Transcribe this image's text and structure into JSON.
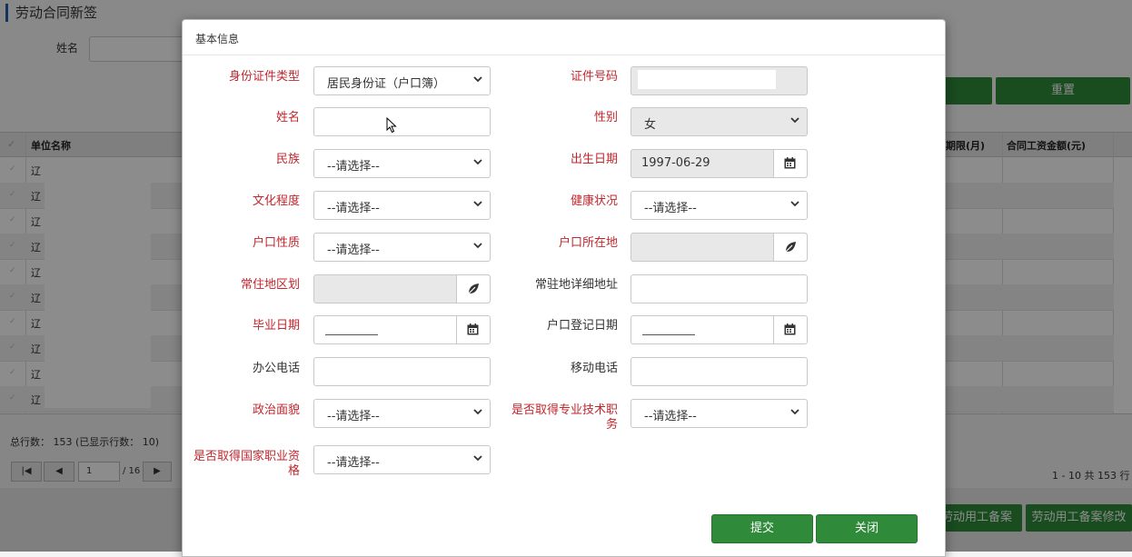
{
  "background": {
    "page_title": "劳动合同新签",
    "search_label": "姓名",
    "reset_button": "重置",
    "grid": {
      "headers": [
        "单位名称",
        "期限(月)",
        "合同工资金额(元)"
      ],
      "row_prefix": [
        "辽",
        "辽",
        "辽",
        "辽",
        "辽",
        "辽",
        "辽",
        "辽",
        "辽",
        "辽"
      ]
    },
    "total_rows": "总行数： 153 (已显示行数： 10)",
    "page_input": "1",
    "page_total": "/ 16",
    "range_info": "1 - 10 共 153 行",
    "bottom_buttons": [
      "劳动用工备案",
      "劳动用工备案修改"
    ]
  },
  "modal": {
    "title": "基本信息",
    "fields": {
      "id_type": {
        "label": "身份证件类型",
        "value": "居民身份证（户口簿）"
      },
      "id_number": {
        "label": "证件号码",
        "value": ""
      },
      "name": {
        "label": "姓名",
        "value": ""
      },
      "gender": {
        "label": "性别",
        "value": "女"
      },
      "ethnicity": {
        "label": "民族",
        "value": "--请选择--"
      },
      "birth_date": {
        "label": "出生日期",
        "value": "1997-06-29"
      },
      "education": {
        "label": "文化程度",
        "value": "--请选择--"
      },
      "health": {
        "label": "健康状况",
        "value": "--请选择--"
      },
      "hukou_type": {
        "label": "户口性质",
        "value": "--请选择--"
      },
      "hukou_location": {
        "label": "户口所在地",
        "value": ""
      },
      "residence_area": {
        "label": "常住地区划",
        "value": ""
      },
      "residence_address": {
        "label": "常驻地详细地址",
        "value": ""
      },
      "graduation_date": {
        "label": "毕业日期",
        "value": ""
      },
      "hukou_reg_date": {
        "label": "户口登记日期",
        "value": ""
      },
      "office_phone": {
        "label": "办公电话",
        "value": ""
      },
      "mobile_phone": {
        "label": "移动电话",
        "value": ""
      },
      "political_status": {
        "label": "政治面貌",
        "value": "--请选择--"
      },
      "professional_title": {
        "label_line1": "是否取得专业技术职",
        "label_line2": "务",
        "value": "--请选择--"
      },
      "national_qualification": {
        "label_line1": "是否取得国家职业资",
        "label_line2": "格",
        "value": "--请选择--"
      }
    },
    "buttons": {
      "submit": "提交",
      "close": "关闭"
    }
  },
  "colors": {
    "required_label": "#c0272d",
    "button_green": "#2f8a3a"
  }
}
